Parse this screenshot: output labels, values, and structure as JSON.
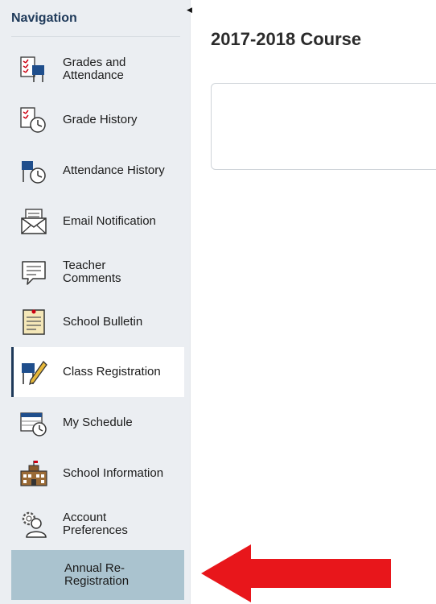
{
  "sidebar": {
    "header": "Navigation",
    "items": [
      {
        "label": "Grades and Attendance",
        "icon": "grades-attendance-icon"
      },
      {
        "label": "Grade History",
        "icon": "grade-history-icon"
      },
      {
        "label": "Attendance History",
        "icon": "attendance-history-icon"
      },
      {
        "label": "Email Notification",
        "icon": "email-notification-icon"
      },
      {
        "label": "Teacher Comments",
        "icon": "teacher-comments-icon"
      },
      {
        "label": "School Bulletin",
        "icon": "school-bulletin-icon"
      },
      {
        "label": "Class Registration",
        "icon": "class-registration-icon",
        "active": true
      },
      {
        "label": "My Schedule",
        "icon": "my-schedule-icon"
      },
      {
        "label": "School Information",
        "icon": "school-information-icon"
      },
      {
        "label": "Account Preferences",
        "icon": "account-preferences-icon"
      },
      {
        "label": "Annual Re-Registration",
        "highlighted": true
      }
    ]
  },
  "main": {
    "title": "2017-2018 Course"
  },
  "colors": {
    "sidebar_bg": "#ebeef2",
    "active_accent": "#1f3a5a",
    "highlight_bg": "#aac3cf",
    "arrow": "#e8161b"
  }
}
